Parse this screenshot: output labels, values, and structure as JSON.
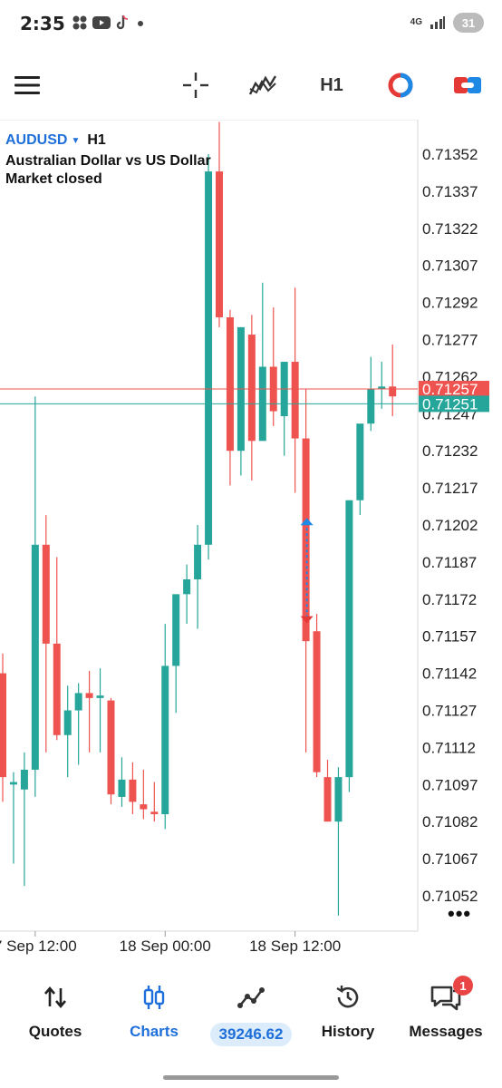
{
  "status_bar": {
    "time": "2:35",
    "network": "4G",
    "battery": "31",
    "icons": [
      "grid-icon",
      "youtube-icon",
      "tiktok-icon",
      "dot-icon"
    ]
  },
  "toolbar": {
    "menu_icon": "hamburger-icon",
    "crosshair_icon": "crosshair-icon",
    "indicators_icon": "indicators-icon",
    "timeframe": "H1",
    "accent_red": "#e53935",
    "accent_blue": "#1e88e5"
  },
  "chart": {
    "symbol": "AUDUSD",
    "timeframe": "H1",
    "description": "Australian Dollar vs US Dollar",
    "status": "Market closed",
    "more_icon": "more-dots-icon",
    "colors": {
      "bull": "#26a69a",
      "bear": "#ef5350",
      "ask_line": "#ef5350",
      "bid_line": "#26a69a"
    }
  },
  "chart_data": {
    "type": "candlestick",
    "timeframe": "H1",
    "y_ticks": [
      "0.71352",
      "0.71337",
      "0.71322",
      "0.71307",
      "0.71292",
      "0.71277",
      "0.71262",
      "0.71247",
      "0.71232",
      "0.71217",
      "0.71202",
      "0.71187",
      "0.71172",
      "0.71157",
      "0.71142",
      "0.71127",
      "0.71112",
      "0.71097",
      "0.71082",
      "0.71067",
      "0.71052"
    ],
    "ylim": [
      0.71042,
      0.71361
    ],
    "x_labels": [
      "7 Sep 12:00",
      "18 Sep 00:00",
      "18 Sep 12:00"
    ],
    "x_label_candle_index": [
      3,
      15,
      27
    ],
    "ask_price": "0.71257",
    "bid_price": "0.71251",
    "ohlc": [
      [
        0.71142,
        0.7115,
        0.7109,
        0.711
      ],
      [
        0.71097,
        0.71102,
        0.71065,
        0.71098
      ],
      [
        0.71095,
        0.7111,
        0.71056,
        0.71103
      ],
      [
        0.71103,
        0.71254,
        0.71092,
        0.71194
      ],
      [
        0.71194,
        0.71206,
        0.7111,
        0.71154
      ],
      [
        0.71154,
        0.71189,
        0.71115,
        0.71117
      ],
      [
        0.71117,
        0.71137,
        0.711,
        0.71127
      ],
      [
        0.71127,
        0.71138,
        0.71105,
        0.71134
      ],
      [
        0.71134,
        0.71143,
        0.7111,
        0.71132
      ],
      [
        0.71132,
        0.71144,
        0.7111,
        0.71133
      ],
      [
        0.71131,
        0.71132,
        0.71089,
        0.71093
      ],
      [
        0.71092,
        0.71108,
        0.71088,
        0.71099
      ],
      [
        0.71099,
        0.71106,
        0.71085,
        0.7109
      ],
      [
        0.71089,
        0.71103,
        0.71083,
        0.71087
      ],
      [
        0.71086,
        0.71098,
        0.71082,
        0.71085
      ],
      [
        0.71085,
        0.71162,
        0.71079,
        0.71145
      ],
      [
        0.71145,
        0.7117,
        0.71126,
        0.71174
      ],
      [
        0.71174,
        0.71186,
        0.71162,
        0.7118
      ],
      [
        0.7118,
        0.71202,
        0.7116,
        0.71194
      ],
      [
        0.71194,
        0.71352,
        0.71188,
        0.71345
      ],
      [
        0.71345,
        0.71365,
        0.71282,
        0.71286
      ],
      [
        0.71286,
        0.71289,
        0.71218,
        0.71232
      ],
      [
        0.71232,
        0.71282,
        0.71222,
        0.71282
      ],
      [
        0.71279,
        0.71287,
        0.7122,
        0.71236
      ],
      [
        0.71236,
        0.713,
        0.71236,
        0.71266
      ],
      [
        0.71266,
        0.7129,
        0.71242,
        0.71248
      ],
      [
        0.71246,
        0.71268,
        0.7123,
        0.71268
      ],
      [
        0.71268,
        0.71298,
        0.71215,
        0.71237
      ],
      [
        0.71237,
        0.71257,
        0.7111,
        0.71155
      ],
      [
        0.71159,
        0.71166,
        0.711,
        0.71102
      ],
      [
        0.711,
        0.71107,
        0.71082,
        0.71082
      ],
      [
        0.71082,
        0.71104,
        0.71044,
        0.711
      ],
      [
        0.711,
        0.7121,
        0.71094,
        0.71212
      ],
      [
        0.71212,
        0.7124,
        0.71206,
        0.71243
      ],
      [
        0.71243,
        0.7127,
        0.7124,
        0.71257
      ],
      [
        0.71257,
        0.71268,
        0.71249,
        0.71258
      ],
      [
        0.71258,
        0.71275,
        0.71246,
        0.71254
      ]
    ],
    "trade_marker": {
      "buy_price": 0.71203,
      "sell_price": 0.71164
    }
  },
  "nav": {
    "items": [
      {
        "label": "Quotes",
        "icon": "quotes-arrows-icon",
        "active": false
      },
      {
        "label": "Charts",
        "icon": "charts-candles-icon",
        "active": true
      },
      {
        "label": "39246.62",
        "icon": "trade-line-icon",
        "active": false
      },
      {
        "label": "History",
        "icon": "history-clock-icon",
        "active": false
      },
      {
        "label": "Messages",
        "icon": "messages-icon",
        "active": false,
        "badge": "1"
      }
    ]
  }
}
